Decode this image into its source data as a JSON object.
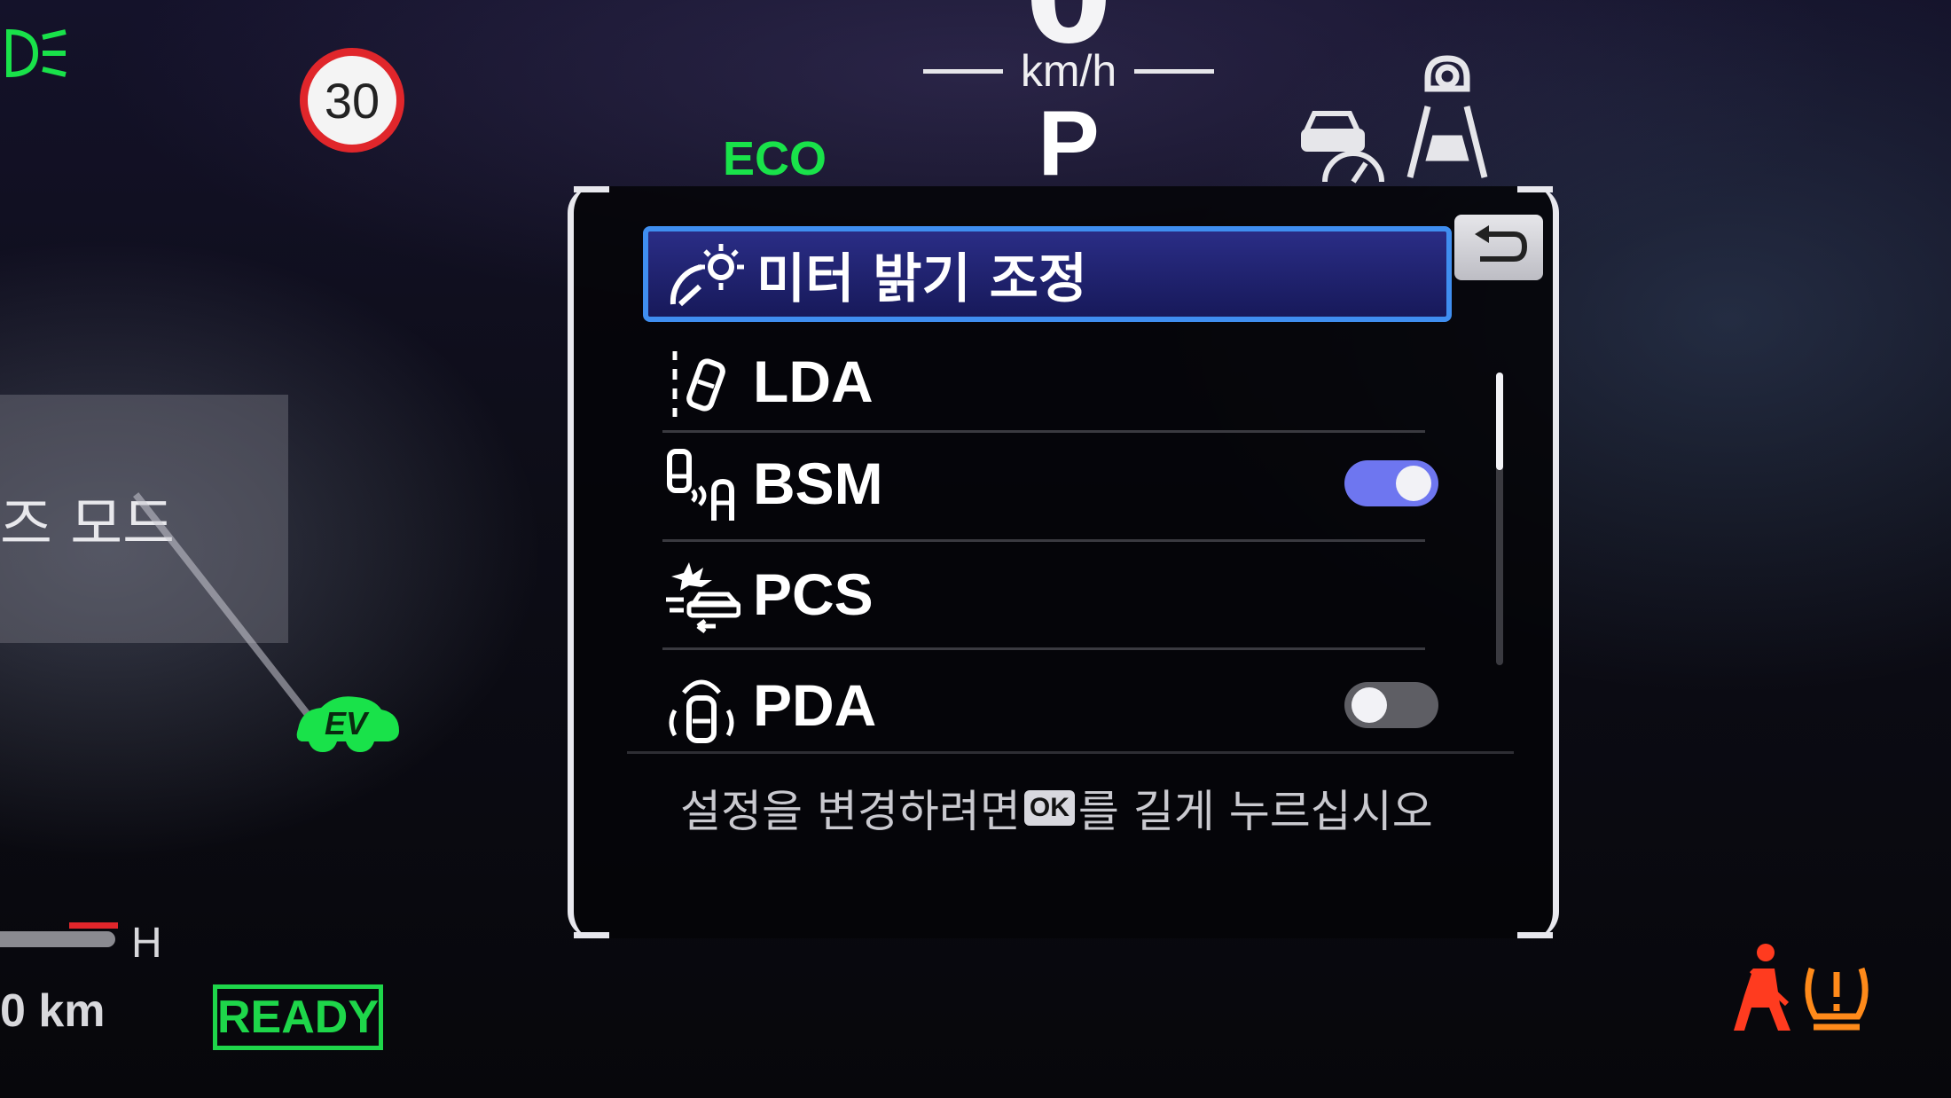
{
  "speed": {
    "value": "0",
    "unit": "km/h"
  },
  "gear": "P",
  "drive_mode_indicator": "ECO",
  "speed_limit": "30",
  "left_panel": {
    "drive_mode_text": "즈 모드",
    "temp_label": "H",
    "range_text": "0 km",
    "ev_label": "EV",
    "ready_label": "READY"
  },
  "menu": {
    "items": [
      {
        "label": "미터 밝기 조정",
        "icon": "meter-brightness-icon",
        "selected": true
      },
      {
        "label": "LDA",
        "icon": "lane-departure-icon"
      },
      {
        "label": "BSM",
        "icon": "blind-spot-icon",
        "toggle": "on"
      },
      {
        "label": "PCS",
        "icon": "pre-collision-icon"
      },
      {
        "label": "PDA",
        "icon": "proactive-driving-icon",
        "toggle": "off"
      }
    ],
    "hint_before": "설정을 변경하려면",
    "hint_key": "OK",
    "hint_after": "를 길게 누르십시오"
  },
  "colors": {
    "eco_green": "#19e24a",
    "ready_green": "#1ed64a",
    "selection_blue": "#3f8ef0",
    "toggle_on": "#6e76f0",
    "warning_red": "#ff3b1f",
    "warning_orange": "#ff8a1a"
  }
}
